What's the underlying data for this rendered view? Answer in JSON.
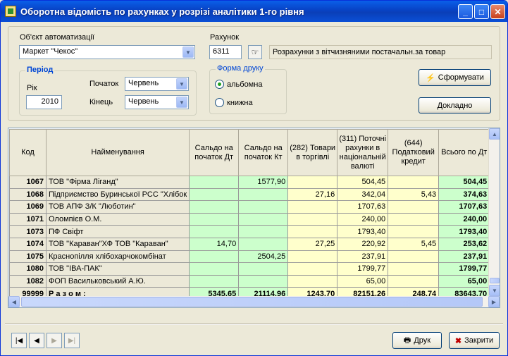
{
  "window": {
    "title": "Оборотна відомість по рахунках у розрізі аналітики 1-го рівня"
  },
  "filters": {
    "object_label": "Об'єкт автоматизації",
    "object_value": "Маркет \"Чекос\"",
    "account_label": "Рахунок",
    "account_value": "6311",
    "account_desc": "Розрахунки з вітчизняними постачальн.за товар",
    "period_legend": "Період",
    "year_label": "Рік",
    "year_value": "2010",
    "start_label": "Початок",
    "start_value": "Червень",
    "end_label": "Кінець",
    "end_value": "Червень",
    "print_legend": "Форма друку",
    "landscape_label": "альбомна",
    "portrait_label": "книжна",
    "landscape_selected": true
  },
  "buttons": {
    "form": "Сформувати",
    "detail": "Докладно",
    "print": "Друк",
    "close": "Закрити"
  },
  "table": {
    "headers": [
      "Код",
      "Найменування",
      "Сальдо на початок Дт",
      "Сальдо на початок Кт",
      "(282) Товари в торгівлі",
      "(311) Поточні рахунки в національній валюті",
      "(644) Податковий кредит",
      "Всього по Дт"
    ],
    "rows": [
      [
        "1067",
        "ТОВ \"Фірма Ліганд\"",
        "",
        "1577,90",
        "",
        "504,45",
        "",
        "504,45"
      ],
      [
        "1068",
        "Підприємство Буринської РСС \"Хлібок",
        "",
        "",
        "27,16",
        "342,04",
        "5,43",
        "374,63"
      ],
      [
        "1069",
        "ТОВ АПФ З/К \"Люботин\"",
        "",
        "",
        "",
        "1707,63",
        "",
        "1707,63"
      ],
      [
        "1071",
        "Оломпієв О.М.",
        "",
        "",
        "",
        "240,00",
        "",
        "240,00"
      ],
      [
        "1073",
        "ПФ Свіфт",
        "",
        "",
        "",
        "1793,40",
        "",
        "1793,40"
      ],
      [
        "1074",
        "ТОВ \"Караван\"ХФ ТОВ \"Караван\"",
        "14,70",
        "",
        "27,25",
        "220,92",
        "5,45",
        "253,62"
      ],
      [
        "1075",
        "Краснопілля хлібохарчокомбінат",
        "",
        "2504,25",
        "",
        "237,91",
        "",
        "237,91"
      ],
      [
        "1080",
        "ТОВ \"ІВА-ПАК\"",
        "",
        "",
        "",
        "1799,77",
        "",
        "1799,77"
      ],
      [
        "1082",
        "ФОП Васильковський А.Ю.",
        "",
        "",
        "",
        "65,00",
        "",
        "65,00"
      ]
    ],
    "total": [
      "99999",
      "Р а з о м :",
      "5345,65",
      "21114,96",
      "1243,70",
      "82151,26",
      "248,74",
      "83643,70"
    ]
  }
}
